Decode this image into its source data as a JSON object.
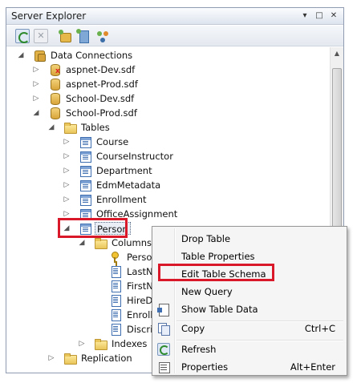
{
  "window": {
    "title": "Server Explorer",
    "title_buttons": [
      "▾",
      "□",
      "✕"
    ]
  },
  "toolbar": {
    "icons": [
      "refresh-icon",
      "stop-icon",
      "connect-to-database-icon",
      "connect-to-server-icon",
      "connect-to-sharepoint-icon"
    ],
    "stop_glyph": "✕"
  },
  "tree": {
    "root": {
      "label": "Data Connections",
      "icon": "data-connections-icon",
      "expander": "◢"
    },
    "databases": [
      {
        "label": "aspnet-Dev.sdf",
        "error": true,
        "expander": "▷"
      },
      {
        "label": "aspnet-Prod.sdf",
        "error": false,
        "expander": "▷"
      },
      {
        "label": "School-Dev.sdf",
        "error": false,
        "expander": "▷"
      },
      {
        "label": "School-Prod.sdf",
        "error": false,
        "expander": "◢"
      }
    ],
    "tables_folder": {
      "label": "Tables",
      "expander": "◢"
    },
    "tables": [
      {
        "label": "Course",
        "expander": "▷"
      },
      {
        "label": "CourseInstructor",
        "expander": "▷"
      },
      {
        "label": "Department",
        "expander": "▷"
      },
      {
        "label": "EdmMetadata",
        "expander": "▷"
      },
      {
        "label": "Enrollment",
        "expander": "▷"
      },
      {
        "label": "OfficeAssignment",
        "expander": "▷"
      },
      {
        "label": "Person",
        "expander": "◢"
      }
    ],
    "columns_folder": {
      "label": "Columns",
      "expander": "◢"
    },
    "columns": [
      {
        "label": "Perso",
        "icon": "key-icon"
      },
      {
        "label": "LastN",
        "icon": "column-icon"
      },
      {
        "label": "FirstN",
        "icon": "column-icon"
      },
      {
        "label": "HireD",
        "icon": "column-icon"
      },
      {
        "label": "Enroll",
        "icon": "column-icon"
      },
      {
        "label": "Discri",
        "icon": "column-icon"
      }
    ],
    "indexes_folder": {
      "label": "Indexes",
      "expander": "▷"
    },
    "replication_folder": {
      "label": "Replication",
      "expander": "▷"
    }
  },
  "scrollbar": {
    "up": "▲",
    "down": "▼"
  },
  "context_menu": {
    "items": [
      {
        "label": "Drop Table",
        "shortcut": "",
        "icon": ""
      },
      {
        "label": "Table Properties",
        "shortcut": "",
        "icon": ""
      },
      {
        "label": "Edit Table Schema",
        "shortcut": "",
        "icon": ""
      },
      {
        "label": "New Query",
        "shortcut": "",
        "icon": ""
      },
      {
        "label": "Show Table Data",
        "shortcut": "",
        "icon": "show-table-data-icon"
      },
      {
        "label": "Copy",
        "shortcut": "Ctrl+C",
        "icon": "copy-icon"
      },
      {
        "label": "Refresh",
        "shortcut": "",
        "icon": "refresh-icon"
      },
      {
        "label": "Properties",
        "shortcut": "Alt+Enter",
        "icon": "properties-icon"
      }
    ]
  },
  "colors": {
    "highlight": "#d9182a",
    "window_border": "#8e9bb0",
    "menu_background": "#f5f5f5"
  }
}
